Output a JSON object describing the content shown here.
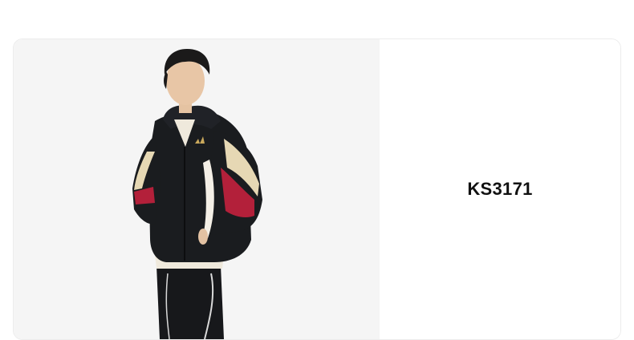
{
  "product": {
    "sku": "KS3171",
    "image_icon": "jacket-model-photo",
    "colors": {
      "photo_bg": "#f5f5f5",
      "jacket_black": "#1a1c1f",
      "accent_red": "#b3203a",
      "accent_cream": "#e6d8b4"
    }
  }
}
